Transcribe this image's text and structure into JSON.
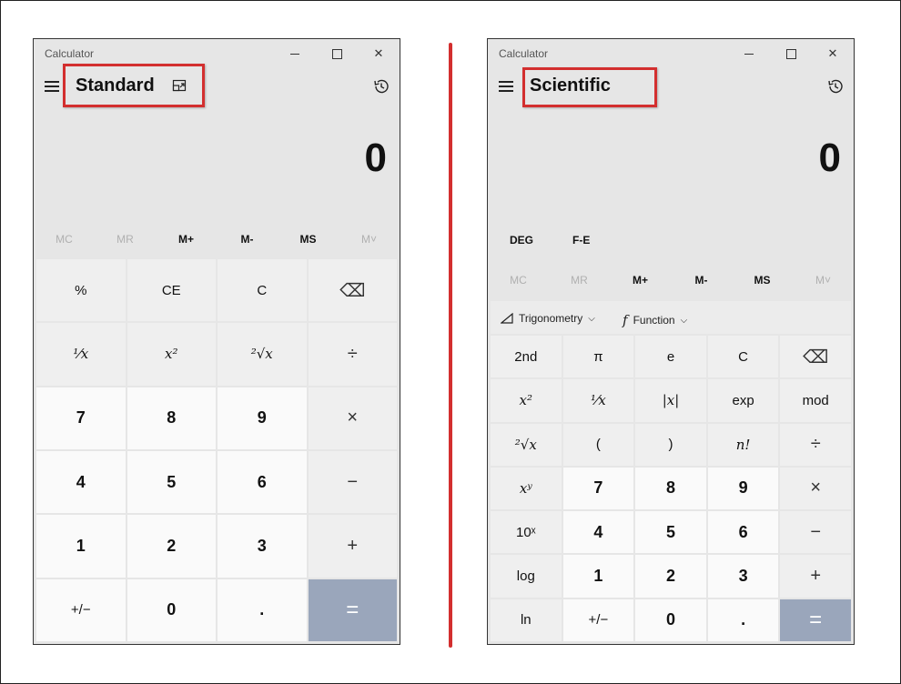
{
  "standard": {
    "app_title": "Calculator",
    "mode": "Standard",
    "display": "0",
    "memory": [
      "MC",
      "MR",
      "M+",
      "M-",
      "MS",
      "M˅"
    ],
    "keys": [
      [
        "%",
        "CE",
        "C",
        "⌫"
      ],
      [
        "⅟x",
        "x²",
        "²√x",
        "÷"
      ],
      [
        "7",
        "8",
        "9",
        "×"
      ],
      [
        "4",
        "5",
        "6",
        "−"
      ],
      [
        "1",
        "2",
        "3",
        "+"
      ],
      [
        "+/−",
        "0",
        ".",
        "="
      ]
    ]
  },
  "scientific": {
    "app_title": "Calculator",
    "mode": "Scientific",
    "display": "0",
    "deg": "DEG",
    "fe": "F-E",
    "memory": [
      "MC",
      "MR",
      "M+",
      "M-",
      "MS",
      "M˅"
    ],
    "trig": "Trigonometry",
    "func": "Function",
    "keys": [
      [
        "2nd",
        "π",
        "e",
        "C",
        "⌫"
      ],
      [
        "x²",
        "⅟x",
        "|x|",
        "exp",
        "mod"
      ],
      [
        "²√x",
        "(",
        ")",
        "n!",
        "÷"
      ],
      [
        "xʸ",
        "7",
        "8",
        "9",
        "×"
      ],
      [
        "10ˣ",
        "4",
        "5",
        "6",
        "−"
      ],
      [
        "log",
        "1",
        "2",
        "3",
        "+"
      ],
      [
        "ln",
        "+/−",
        "0",
        ".",
        "="
      ]
    ]
  },
  "colors": {
    "highlight": "#d32f2f",
    "equals": "#9aa6bb",
    "background": "#e6e6e6"
  },
  "icons": [
    "hamburger-icon",
    "keep-on-top-icon",
    "history-icon",
    "minimize-icon",
    "maximize-icon",
    "close-icon",
    "backspace-icon",
    "triangle-icon",
    "function-icon",
    "chevron-down-icon"
  ]
}
